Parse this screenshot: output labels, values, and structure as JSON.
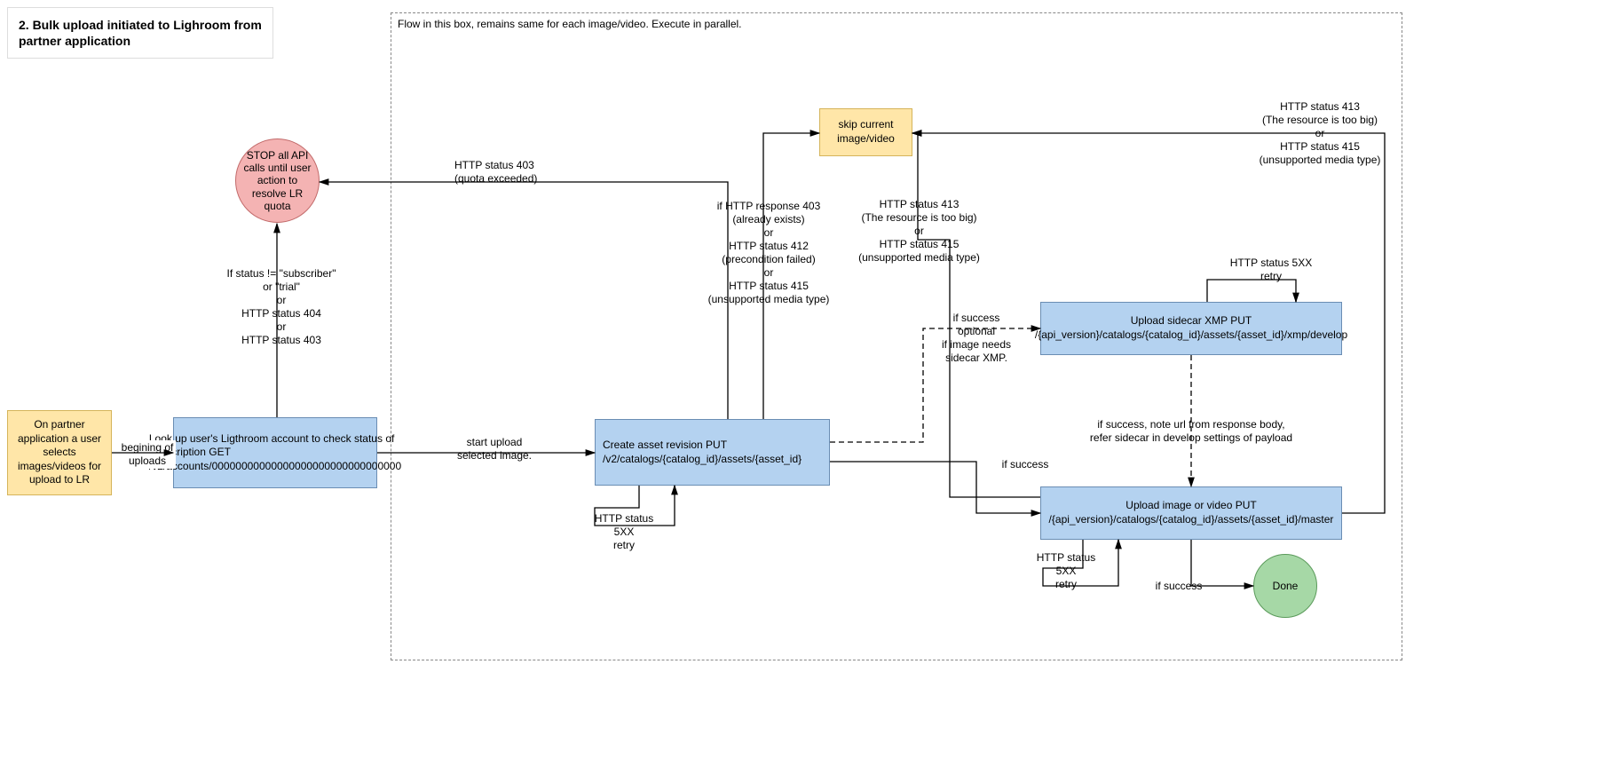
{
  "title": "2. Bulk upload initiated to Lighroom from partner application",
  "parallel_note": "Flow in this box, remains same for each image/video. Execute in parallel.",
  "nodes": {
    "start": "On partner application a user selects images/videos for upload to LR",
    "lookup": "Look up user's Ligthroom account to check status of subscription  GET /v2/accounts/00000000000000000000000000000000",
    "stop": "STOP all API calls until user action to resolve LR quota",
    "create_asset": "Create asset revision PUT /v2/catalogs/{catalog_id}/assets/{asset_id}",
    "skip": "skip current image/video",
    "upload_xmp": "Upload sidecar XMP PUT /{api_version}/catalogs/{catalog_id}/assets/{asset_id}/xmp/develop",
    "upload_master": "Upload image or video  PUT /{api_version}/catalogs/{catalog_id}/assets/{asset_id}/master",
    "done": "Done"
  },
  "labels": {
    "begin": "begining of uploads",
    "status_fail": "If status != \"subscriber\" or \"trial\"\nor\nHTTP status 404\nor\nHTTP status 403",
    "quota": "HTTP status 403\n(quota exceeded)",
    "start_upload": "start upload selected image.",
    "retry_5xx": "HTTP status 5XX\nretry",
    "skip_reasons_asset": "if HTTP response 403\n(already exists)\nor\nHTTP status 412\n(precondition failed)\nor\nHTTP status 415\n(unsupported media type)",
    "skip_reasons_413_415": "HTTP status 413\n(The resource is too big)\nor\nHTTP status 415\n(unsupported media type)",
    "if_success": "if success",
    "if_success_optional": "if success\noptional\nif image needs\nsidecar XMP.",
    "sidecar_ref": "if success, note url from response body,\nrefer sidecar in develop settings of payload",
    "xmp_retry": "HTTP status 5XX\nretry",
    "master_retry": "HTTP status 5XX\nretry",
    "done_label": "if success"
  }
}
